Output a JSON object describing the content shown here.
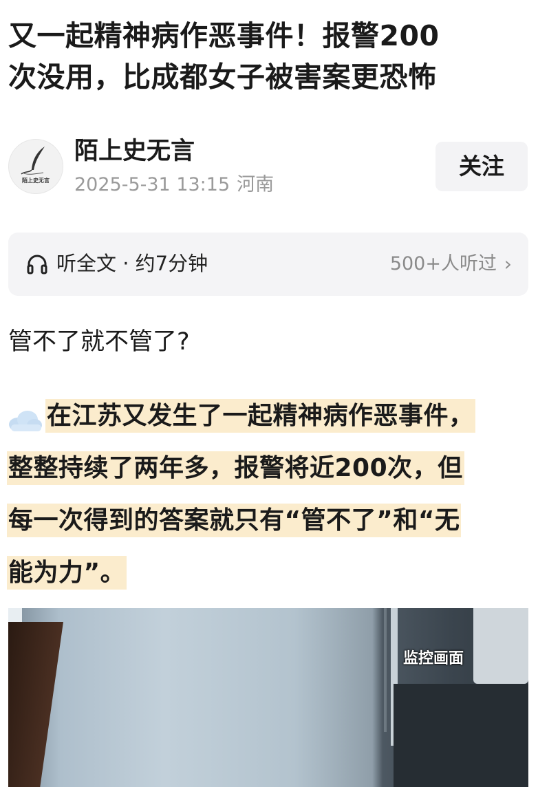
{
  "article": {
    "title_line1": "又一起精神病作恶事件！报警200",
    "title_line2": "次没用，比成都女子被害案更恐怖"
  },
  "author": {
    "name": "陌上史无言",
    "avatar_text": "陌上史无言",
    "date": "2025-5-31 13:15",
    "location": "河南",
    "follow_label": "关注"
  },
  "listen": {
    "icon": "headphones-icon",
    "label": "听全文 · 约7分钟",
    "count": "500+人听过",
    "chevron": "›"
  },
  "body": {
    "question": "管不了就不管了?",
    "para_icon": "cloud-icon",
    "highlight_color": "#fbeccd",
    "lines": [
      "在江苏又发生了一起精神病作恶事件，",
      "整整持续了两年多，报警将近200次，但",
      "每一次得到的答案就只有“管不了”和“无",
      "能为力”。"
    ]
  },
  "video": {
    "caption": "监控画面"
  }
}
